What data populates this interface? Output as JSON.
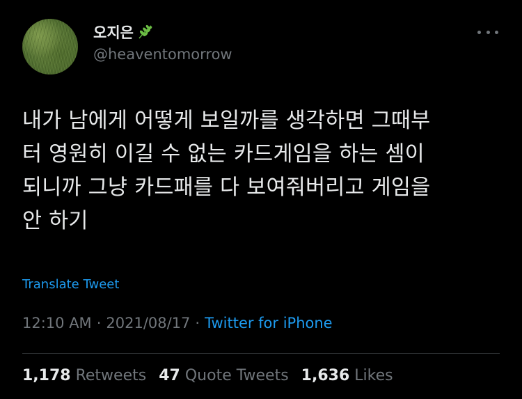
{
  "author": {
    "display_name": "오지은",
    "display_name_emoji_icon": "herb-leaf-icon",
    "handle": "@heaventomorrow"
  },
  "menu": {
    "more_icon": "more-dots-icon"
  },
  "tweet": {
    "text": "내가 남에게 어떻게 보일까를 생각하면 그때부\n터 영원히 이길 수 없는 카드게임을 하는 셈이\n되니까 그냥 카드패를 다 보여줘버리고 게임을\n안 하기",
    "translate_label": "Translate Tweet"
  },
  "meta": {
    "time": "12:10 AM",
    "separator": "·",
    "date": "2021/08/17",
    "source": "Twitter for iPhone"
  },
  "stats": {
    "retweets_count": "1,178",
    "retweets_label": "Retweets",
    "quotes_count": "47",
    "quotes_label": "Quote Tweets",
    "likes_count": "1,636",
    "likes_label": "Likes"
  },
  "colors": {
    "background": "#000000",
    "primary_text": "#e7e9ea",
    "secondary_text": "#71767b",
    "accent": "#1d9bf0",
    "divider": "#2f3336"
  }
}
